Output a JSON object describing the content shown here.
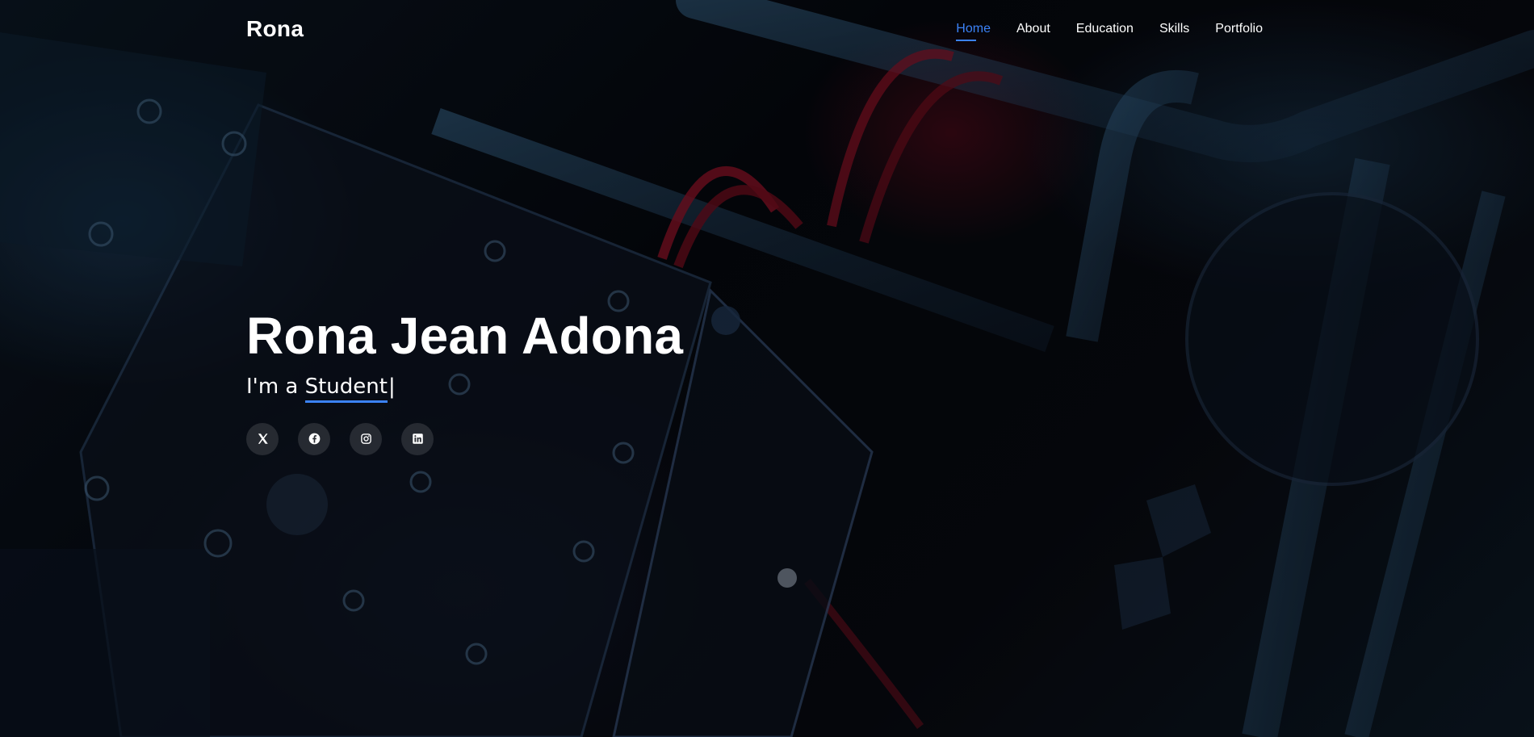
{
  "header": {
    "logo": "Rona",
    "nav": [
      "Home",
      "About",
      "Education",
      "Skills",
      "Portfolio"
    ],
    "active_nav": "Home"
  },
  "hero": {
    "name": "Rona Jean Adona",
    "tagline_prefix": "I'm a ",
    "tagline_typed": "Student",
    "cursor": "|"
  },
  "socials": [
    {
      "icon": "x-twitter-icon"
    },
    {
      "icon": "facebook-icon"
    },
    {
      "icon": "instagram-icon"
    },
    {
      "icon": "linkedin-icon"
    }
  ],
  "colors": {
    "accent": "#3b82f6",
    "text": "#ffffff",
    "background": "#05060a"
  }
}
